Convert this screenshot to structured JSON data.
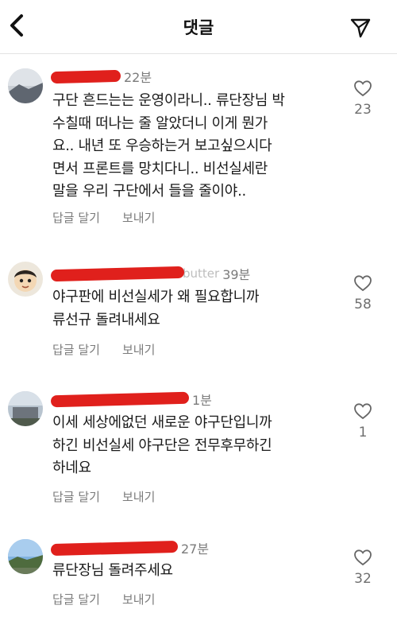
{
  "header": {
    "title": "댓글",
    "back_icon": "chevron-left-icon",
    "send_icon": "paper-plane-icon"
  },
  "actions": {
    "reply_label": "답글 달기",
    "send_label": "보내기"
  },
  "comments": [
    {
      "author_tail": "",
      "time": "22분",
      "lines": [
        "구단 흔드는는 운영이라니.. 류단장님 박",
        "수칠때 떠나는 줄 알았더니 이게 뭔가",
        "요.. 내년 또 우승하는거 보고싶으시다",
        "면서 프론트를 망치다니.. 비선실세란",
        "말을 우리 구단에서 들을 줄이야.."
      ],
      "likes": "23"
    },
    {
      "author_tail": "butter",
      "time": "39분",
      "lines": [
        "야구판에 비선실세가 왜 필요합니까",
        "류선규 돌려내세요"
      ],
      "likes": "58"
    },
    {
      "author_tail": "",
      "time": "1분",
      "lines": [
        "이세 세상에없던 새로운 야구단입니까",
        "하긴 비선실세 야구단은 전무후무하긴",
        "하네요"
      ],
      "likes": "1"
    },
    {
      "author_tail": "",
      "time": "27분",
      "lines": [
        "류단장님 돌려주세요"
      ],
      "likes": "32"
    }
  ],
  "colors": {
    "redaction": "#e0201c",
    "secondary_text": "#7b7b7b",
    "primary_text": "#1a1a1a"
  }
}
